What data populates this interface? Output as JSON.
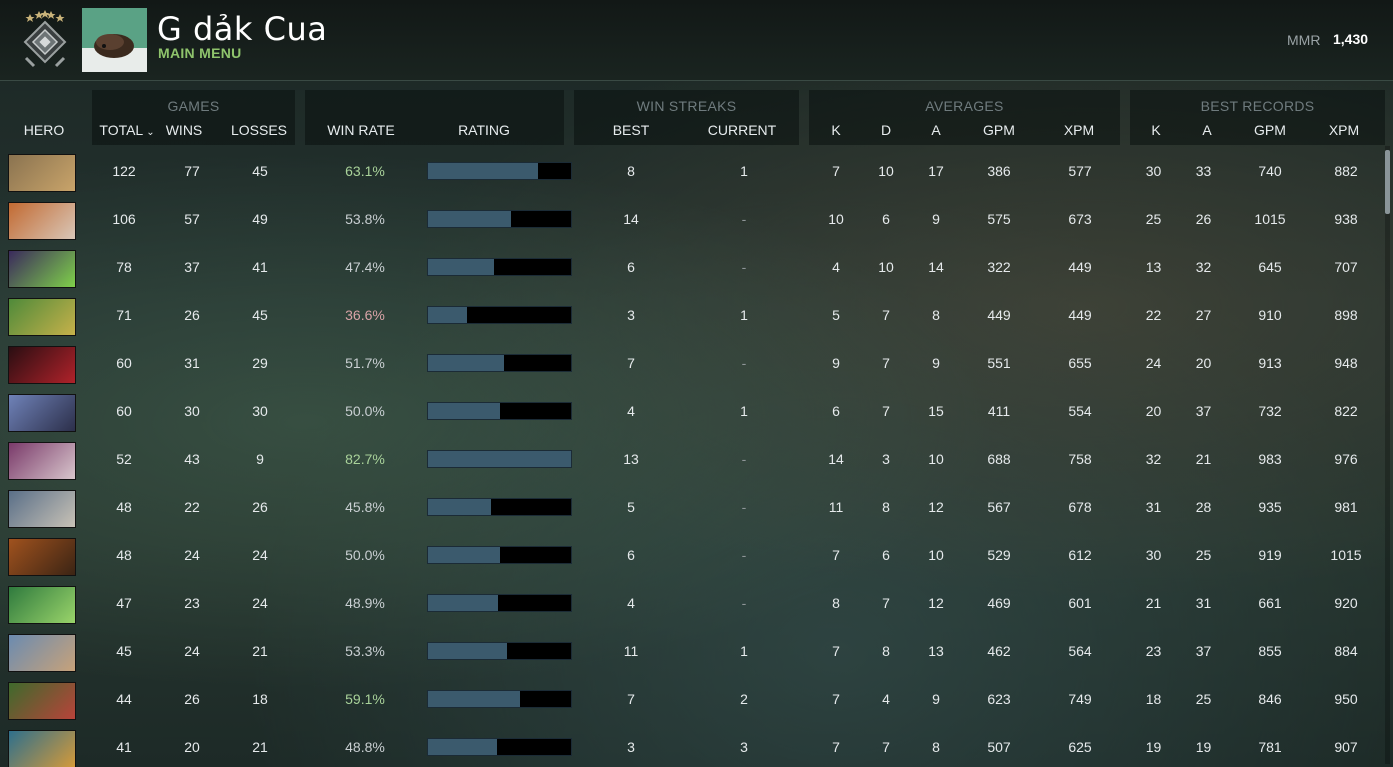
{
  "player": {
    "name": "G dảk Cua",
    "menu_link": "MAIN MENU",
    "mmr_label": "MMR",
    "mmr_value": "1,430",
    "rank_icon": "rank-medal-icon",
    "avatar_icon": "player-avatar"
  },
  "groups": {
    "games": "GAMES",
    "win_streaks": "WIN STREAKS",
    "averages": "AVERAGES",
    "best_records": "BEST RECORDS"
  },
  "columns": {
    "hero": "HERO",
    "total": "TOTAL",
    "wins": "WINS",
    "losses": "LOSSES",
    "win_rate": "WIN RATE",
    "rating": "RATING",
    "best": "BEST",
    "current": "CURRENT",
    "avg_k": "K",
    "avg_d": "D",
    "avg_a": "A",
    "avg_gpm": "GPM",
    "avg_xpm": "XPM",
    "best_k": "K",
    "best_a": "A",
    "best_gpm": "GPM",
    "best_xpm": "XPM"
  },
  "colors": {
    "rating_fill": "#3b5a6d",
    "rating_track": "#000000",
    "win_rate_good": "#a9d29a",
    "win_rate_bad": "#d9a3a7",
    "accent_green": "#8fc46c"
  },
  "rows": [
    {
      "hero_colors": [
        "#8a7350",
        "#c9a46a"
      ],
      "total": "122",
      "wins": "77",
      "losses": "45",
      "win_rate": "63.1%",
      "rating": 0.77,
      "best": "8",
      "current": "1",
      "k": "7",
      "d": "10",
      "a": "17",
      "gpm": "386",
      "xpm": "577",
      "bk": "30",
      "ba": "33",
      "bgpm": "740",
      "bxpm": "882"
    },
    {
      "hero_colors": [
        "#c26a32",
        "#d9c7b8"
      ],
      "total": "106",
      "wins": "57",
      "losses": "49",
      "win_rate": "53.8%",
      "rating": 0.58,
      "best": "14",
      "current": "-",
      "k": "10",
      "d": "6",
      "a": "9",
      "gpm": "575",
      "xpm": "673",
      "bk": "25",
      "ba": "26",
      "bgpm": "1015",
      "bxpm": "938"
    },
    {
      "hero_colors": [
        "#3a2a5c",
        "#7fd14a"
      ],
      "total": "78",
      "wins": "37",
      "losses": "41",
      "win_rate": "47.4%",
      "rating": 0.46,
      "best": "6",
      "current": "-",
      "k": "4",
      "d": "10",
      "a": "14",
      "gpm": "322",
      "xpm": "449",
      "bk": "13",
      "ba": "32",
      "bgpm": "645",
      "bxpm": "707"
    },
    {
      "hero_colors": [
        "#4f8a3a",
        "#c6b14a"
      ],
      "total": "71",
      "wins": "26",
      "losses": "45",
      "win_rate": "36.6%",
      "rating": 0.27,
      "best": "3",
      "current": "1",
      "k": "5",
      "d": "7",
      "a": "8",
      "gpm": "449",
      "xpm": "449",
      "bk": "22",
      "ba": "27",
      "bgpm": "910",
      "bxpm": "898"
    },
    {
      "hero_colors": [
        "#2a0e12",
        "#b0222a"
      ],
      "total": "60",
      "wins": "31",
      "losses": "29",
      "win_rate": "51.7%",
      "rating": 0.53,
      "best": "7",
      "current": "-",
      "k": "9",
      "d": "7",
      "a": "9",
      "gpm": "551",
      "xpm": "655",
      "bk": "24",
      "ba": "20",
      "bgpm": "913",
      "bxpm": "948"
    },
    {
      "hero_colors": [
        "#6f82b8",
        "#2c2f4a"
      ],
      "total": "60",
      "wins": "30",
      "losses": "30",
      "win_rate": "50.0%",
      "rating": 0.5,
      "best": "4",
      "current": "1",
      "k": "6",
      "d": "7",
      "a": "15",
      "gpm": "411",
      "xpm": "554",
      "bk": "20",
      "ba": "37",
      "bgpm": "732",
      "bxpm": "822"
    },
    {
      "hero_colors": [
        "#7a3a6a",
        "#d8c6cc"
      ],
      "total": "52",
      "wins": "43",
      "losses": "9",
      "win_rate": "82.7%",
      "rating": 1.0,
      "best": "13",
      "current": "-",
      "k": "14",
      "d": "3",
      "a": "10",
      "gpm": "688",
      "xpm": "758",
      "bk": "32",
      "ba": "21",
      "bgpm": "983",
      "bxpm": "976"
    },
    {
      "hero_colors": [
        "#5a6f88",
        "#c8c2b6"
      ],
      "total": "48",
      "wins": "22",
      "losses": "26",
      "win_rate": "45.8%",
      "rating": 0.44,
      "best": "5",
      "current": "-",
      "k": "11",
      "d": "8",
      "a": "12",
      "gpm": "567",
      "xpm": "678",
      "bk": "31",
      "ba": "28",
      "bgpm": "935",
      "bxpm": "981"
    },
    {
      "hero_colors": [
        "#a0521e",
        "#3b2414"
      ],
      "total": "48",
      "wins": "24",
      "losses": "24",
      "win_rate": "50.0%",
      "rating": 0.5,
      "best": "6",
      "current": "-",
      "k": "7",
      "d": "6",
      "a": "10",
      "gpm": "529",
      "xpm": "612",
      "bk": "30",
      "ba": "25",
      "bgpm": "919",
      "bxpm": "1015"
    },
    {
      "hero_colors": [
        "#2f7a3e",
        "#9ad46a"
      ],
      "total": "47",
      "wins": "23",
      "losses": "24",
      "win_rate": "48.9%",
      "rating": 0.49,
      "best": "4",
      "current": "-",
      "k": "8",
      "d": "7",
      "a": "12",
      "gpm": "469",
      "xpm": "601",
      "bk": "21",
      "ba": "31",
      "bgpm": "661",
      "bxpm": "920"
    },
    {
      "hero_colors": [
        "#6b8bb0",
        "#c7a27a"
      ],
      "total": "45",
      "wins": "24",
      "losses": "21",
      "win_rate": "53.3%",
      "rating": 0.55,
      "best": "11",
      "current": "1",
      "k": "7",
      "d": "8",
      "a": "13",
      "gpm": "462",
      "xpm": "564",
      "bk": "23",
      "ba": "37",
      "bgpm": "855",
      "bxpm": "884"
    },
    {
      "hero_colors": [
        "#3e6a2c",
        "#b8433a"
      ],
      "total": "44",
      "wins": "26",
      "losses": "18",
      "win_rate": "59.1%",
      "rating": 0.64,
      "best": "7",
      "current": "2",
      "k": "7",
      "d": "4",
      "a": "9",
      "gpm": "623",
      "xpm": "749",
      "bk": "18",
      "ba": "25",
      "bgpm": "846",
      "bxpm": "950"
    },
    {
      "hero_colors": [
        "#2e6f8c",
        "#d49a3a"
      ],
      "total": "41",
      "wins": "20",
      "losses": "21",
      "win_rate": "48.8%",
      "rating": 0.48,
      "best": "3",
      "current": "3",
      "k": "7",
      "d": "7",
      "a": "8",
      "gpm": "507",
      "xpm": "625",
      "bk": "19",
      "ba": "19",
      "bgpm": "781",
      "bxpm": "907"
    }
  ]
}
